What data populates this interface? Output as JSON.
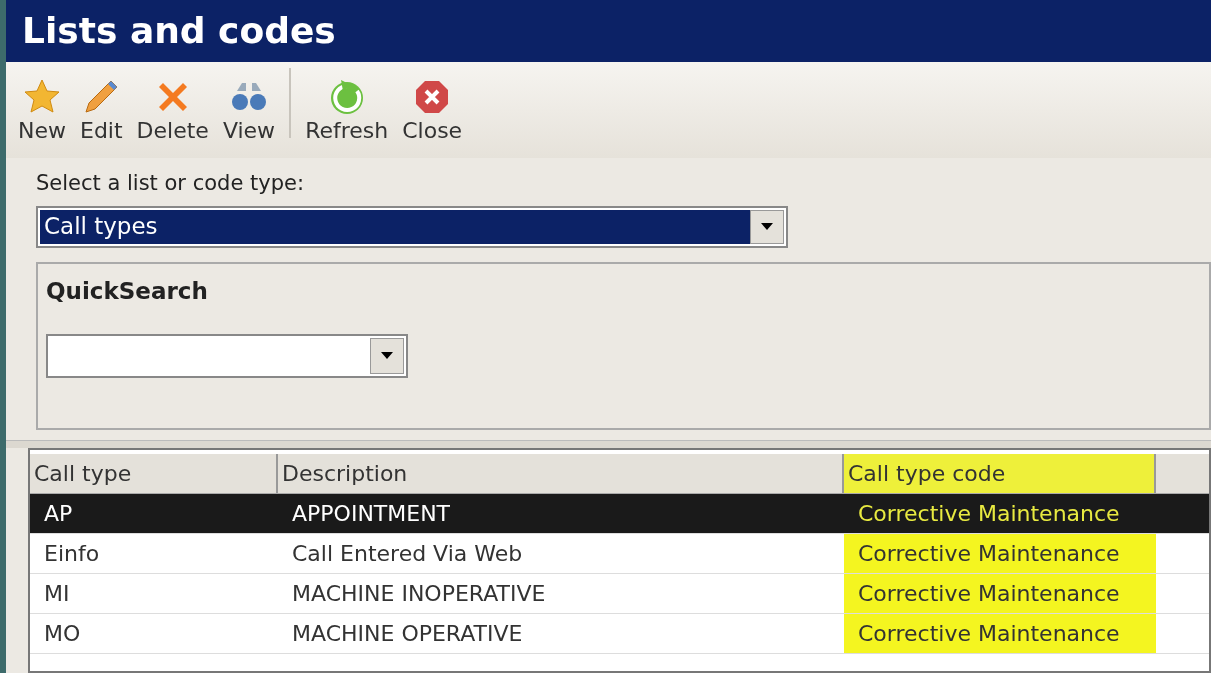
{
  "window": {
    "title": "Lists and codes"
  },
  "toolbar": [
    {
      "kind": "star",
      "label": "New"
    },
    {
      "kind": "pencil",
      "label": "Edit"
    },
    {
      "kind": "cross",
      "label": "Delete"
    },
    {
      "kind": "binoculars",
      "label": "View"
    },
    {
      "kind": "refresh",
      "label": "Refresh"
    },
    {
      "kind": "close",
      "label": "Close"
    }
  ],
  "list_select": {
    "label": "Select a list or code type:",
    "value": "Call types"
  },
  "quick_search": {
    "title": "QuickSearch"
  },
  "table": {
    "columns": [
      {
        "label": "Call type",
        "highlighted": false
      },
      {
        "label": "Description",
        "highlighted": false
      },
      {
        "label": "Call type code",
        "highlighted": true
      }
    ],
    "rows": [
      {
        "cells": [
          "AP",
          "APPOINTMENT",
          "Corrective Maintenance"
        ],
        "selected": true
      },
      {
        "cells": [
          "Einfo",
          "Call Entered Via Web",
          "Corrective Maintenance"
        ],
        "selected": false
      },
      {
        "cells": [
          "MI",
          "MACHINE INOPERATIVE",
          "Corrective Maintenance"
        ],
        "selected": false
      },
      {
        "cells": [
          "MO",
          "MACHINE OPERATIVE",
          "Corrective Maintenance"
        ],
        "selected": false
      }
    ]
  }
}
